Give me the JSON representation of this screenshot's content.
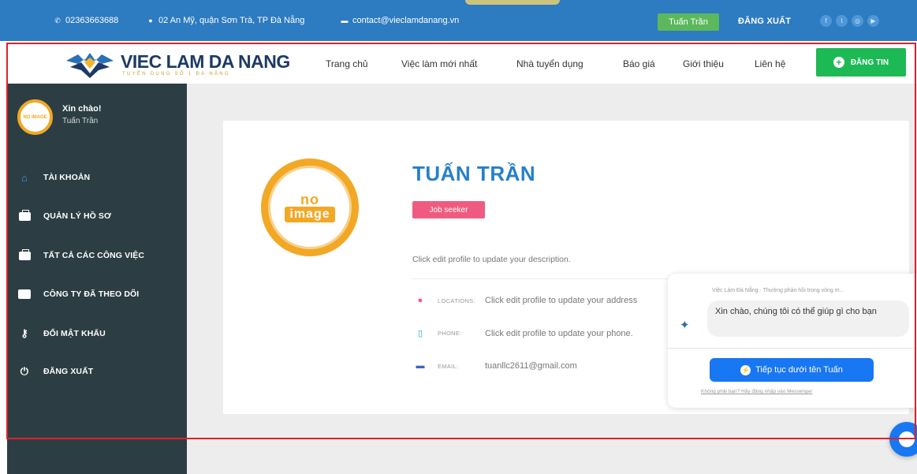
{
  "topbar": {
    "phone": "02363663688",
    "address": "02 An Mỹ, quận Sơn Trà, TP Đà Nẵng",
    "email": "contact@vieclamdanang.vn",
    "user_button": "Tuấn Trần",
    "logout": "ĐĂNG XUẤT",
    "socials": [
      "facebook-icon",
      "twitter-icon",
      "instagram-icon",
      "youtube-icon"
    ]
  },
  "header": {
    "logo_title": "VIEC LAM DA NANG",
    "logo_sub": "TUYỂN DỤNG SỐ 1 ĐÀ NẴNG",
    "nav": [
      "Trang chủ",
      "Việc làm mới nhất",
      "Nhà tuyển dụng",
      "Báo giá",
      "Giới thiệu",
      "Liên hệ"
    ],
    "post_button": "ĐĂNG TIN"
  },
  "sidebar": {
    "hello": "Xin chào!",
    "user": "Tuấn Trần",
    "avatar_text": "NO IMAGE",
    "items": [
      {
        "label": "TÀI KHOẢN",
        "icon": "user-icon"
      },
      {
        "label": "QUẢN LÝ HỒ SƠ",
        "icon": "briefcase-icon"
      },
      {
        "label": "TẤT CẢ CÁC CÔNG VIỆC",
        "icon": "briefcase-icon"
      },
      {
        "label": "CÔNG TY ĐÃ THEO DÕI",
        "icon": "card-icon"
      },
      {
        "label": "ĐỔI MẬT KHẨU",
        "icon": "key-icon"
      },
      {
        "label": "ĐĂNG XUẤT",
        "icon": "power-icon"
      }
    ]
  },
  "profile": {
    "no_image_top": "no",
    "no_image_bottom": "image",
    "name": "TUẤN TRẦN",
    "badge": "Job seeker",
    "description": "Click edit profile to update your description.",
    "location_label": "LOCATIONS:",
    "location_value": "Click edit profile to update your address",
    "phone_label": "PHONE:",
    "phone_value": "Click edit profile to update your phone.",
    "email_label": "EMAIL:",
    "email_value": "tuanllc2611@gmail.com"
  },
  "chat": {
    "header": "Việc Làm Đà Nẵng · Thường phản hồi trong vòng m...",
    "message": "Xin chào, chúng tôi có thể giúp gì cho bạn",
    "button": "Tiếp tục dưới tên Tuấn",
    "footer": "Không phải bạn? Hãy đăng nhập vào Messenger"
  },
  "colors": {
    "topbar": "#2d7bc0",
    "sidebar": "#2c3e44",
    "accent_green": "#1db954",
    "badge_pink": "#ef5b80",
    "name_blue": "#2780c8",
    "highlight_red": "#e0202a"
  }
}
